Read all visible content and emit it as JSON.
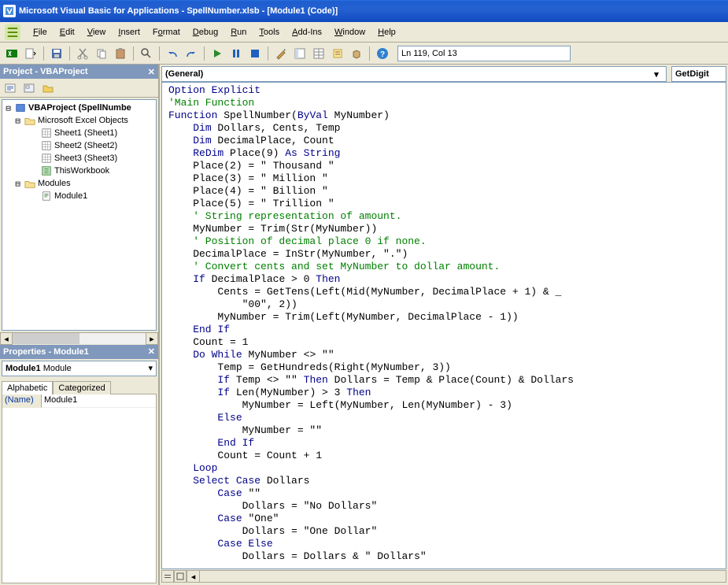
{
  "title": "Microsoft Visual Basic for Applications - SpellNumber.xlsb - [Module1 (Code)]",
  "menu": {
    "file": "File",
    "edit": "Edit",
    "view": "View",
    "insert": "Insert",
    "format": "Format",
    "debug": "Debug",
    "run": "Run",
    "tools": "Tools",
    "addins": "Add-Ins",
    "window": "Window",
    "help": "Help"
  },
  "toolbar": {
    "status": "Ln 119, Col 13"
  },
  "panels": {
    "project_title": "Project - VBAProject",
    "properties_title": "Properties - Module1"
  },
  "project_tree": {
    "root": "VBAProject (SpellNumbe",
    "excel_objects": "Microsoft Excel Objects",
    "sheet1": "Sheet1 (Sheet1)",
    "sheet2": "Sheet2 (Sheet2)",
    "sheet3": "Sheet3 (Sheet3)",
    "workbook": "ThisWorkbook",
    "modules": "Modules",
    "module1": "Module1"
  },
  "properties": {
    "dropdown_name": "Module1",
    "dropdown_type": "Module",
    "tab_alpha": "Alphabetic",
    "tab_cat": "Categorized",
    "row_name_key": "(Name)",
    "row_name_val": "Module1"
  },
  "code": {
    "scope_dd": "(General)",
    "proc_dd": "GetDigit",
    "lines": [
      {
        "t": "kw",
        "s": "Option Explicit"
      },
      {
        "t": "cm",
        "s": "'Main Function"
      },
      {
        "t": "mix",
        "parts": [
          {
            "t": "kw",
            "s": "Function"
          },
          {
            "t": "",
            "s": " SpellNumber("
          },
          {
            "t": "kw",
            "s": "ByVal"
          },
          {
            "t": "",
            "s": " MyNumber)"
          }
        ]
      },
      {
        "t": "mix",
        "indent": 4,
        "parts": [
          {
            "t": "kw",
            "s": "Dim"
          },
          {
            "t": "",
            "s": " Dollars, Cents, Temp"
          }
        ]
      },
      {
        "t": "mix",
        "indent": 4,
        "parts": [
          {
            "t": "kw",
            "s": "Dim"
          },
          {
            "t": "",
            "s": " DecimalPlace, Count"
          }
        ]
      },
      {
        "t": "mix",
        "indent": 4,
        "parts": [
          {
            "t": "kw",
            "s": "ReDim"
          },
          {
            "t": "",
            "s": " Place(9) "
          },
          {
            "t": "kw",
            "s": "As String"
          }
        ]
      },
      {
        "t": "",
        "indent": 4,
        "s": "Place(2) = \" Thousand \""
      },
      {
        "t": "",
        "indent": 4,
        "s": "Place(3) = \" Million \""
      },
      {
        "t": "",
        "indent": 4,
        "s": "Place(4) = \" Billion \""
      },
      {
        "t": "",
        "indent": 4,
        "s": "Place(5) = \" Trillion \""
      },
      {
        "t": "cm",
        "indent": 4,
        "s": "' String representation of amount."
      },
      {
        "t": "",
        "indent": 4,
        "s": "MyNumber = Trim(Str(MyNumber))"
      },
      {
        "t": "cm",
        "indent": 4,
        "s": "' Position of decimal place 0 if none."
      },
      {
        "t": "",
        "indent": 4,
        "s": "DecimalPlace = InStr(MyNumber, \".\")"
      },
      {
        "t": "cm",
        "indent": 4,
        "s": "' Convert cents and set MyNumber to dollar amount."
      },
      {
        "t": "mix",
        "indent": 4,
        "parts": [
          {
            "t": "kw",
            "s": "If"
          },
          {
            "t": "",
            "s": " DecimalPlace > 0 "
          },
          {
            "t": "kw",
            "s": "Then"
          }
        ]
      },
      {
        "t": "",
        "indent": 8,
        "s": "Cents = GetTens(Left(Mid(MyNumber, DecimalPlace + 1) & _"
      },
      {
        "t": "",
        "indent": 12,
        "s": "\"00\", 2))"
      },
      {
        "t": "",
        "indent": 8,
        "s": "MyNumber = Trim(Left(MyNumber, DecimalPlace - 1))"
      },
      {
        "t": "kw",
        "indent": 4,
        "s": "End If"
      },
      {
        "t": "",
        "indent": 4,
        "s": "Count = 1"
      },
      {
        "t": "mix",
        "indent": 4,
        "parts": [
          {
            "t": "kw",
            "s": "Do While"
          },
          {
            "t": "",
            "s": " MyNumber <> \"\""
          }
        ]
      },
      {
        "t": "",
        "indent": 8,
        "s": "Temp = GetHundreds(Right(MyNumber, 3))"
      },
      {
        "t": "mix",
        "indent": 8,
        "parts": [
          {
            "t": "kw",
            "s": "If"
          },
          {
            "t": "",
            "s": " Temp <> \"\" "
          },
          {
            "t": "kw",
            "s": "Then"
          },
          {
            "t": "",
            "s": " Dollars = Temp & Place(Count) & Dollars"
          }
        ]
      },
      {
        "t": "mix",
        "indent": 8,
        "parts": [
          {
            "t": "kw",
            "s": "If"
          },
          {
            "t": "",
            "s": " Len(MyNumber) > 3 "
          },
          {
            "t": "kw",
            "s": "Then"
          }
        ]
      },
      {
        "t": "",
        "indent": 12,
        "s": "MyNumber = Left(MyNumber, Len(MyNumber) - 3)"
      },
      {
        "t": "kw",
        "indent": 8,
        "s": "Else"
      },
      {
        "t": "",
        "indent": 12,
        "s": "MyNumber = \"\""
      },
      {
        "t": "kw",
        "indent": 8,
        "s": "End If"
      },
      {
        "t": "",
        "indent": 8,
        "s": "Count = Count + 1"
      },
      {
        "t": "kw",
        "indent": 4,
        "s": "Loop"
      },
      {
        "t": "mix",
        "indent": 4,
        "parts": [
          {
            "t": "kw",
            "s": "Select Case"
          },
          {
            "t": "",
            "s": " Dollars"
          }
        ]
      },
      {
        "t": "mix",
        "indent": 8,
        "parts": [
          {
            "t": "kw",
            "s": "Case"
          },
          {
            "t": "",
            "s": " \"\""
          }
        ]
      },
      {
        "t": "",
        "indent": 12,
        "s": "Dollars = \"No Dollars\""
      },
      {
        "t": "mix",
        "indent": 8,
        "parts": [
          {
            "t": "kw",
            "s": "Case"
          },
          {
            "t": "",
            "s": " \"One\""
          }
        ]
      },
      {
        "t": "",
        "indent": 12,
        "s": "Dollars = \"One Dollar\""
      },
      {
        "t": "kw",
        "indent": 8,
        "s": "Case Else"
      },
      {
        "t": "",
        "indent": 12,
        "s": "Dollars = Dollars & \" Dollars\""
      }
    ]
  }
}
